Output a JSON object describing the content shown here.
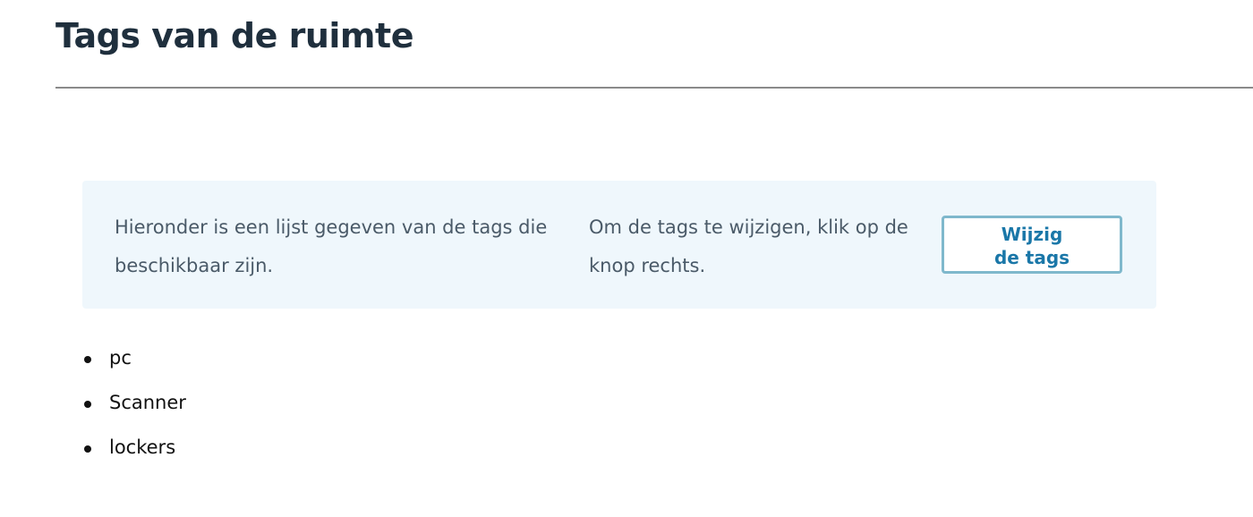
{
  "page": {
    "title": "Tags van de ruimte"
  },
  "info_panel": {
    "description": "Hieronder is een lijst gegeven van de tags die beschikbaar zijn.",
    "instruction": "Om de tags te wijzigen, klik op de knop rechts.",
    "edit_button": {
      "line1": "Wijzig",
      "line2": "de tags"
    }
  },
  "tags": [
    "pc",
    "Scanner",
    "lockers"
  ],
  "colors": {
    "title": "#1f2f3d",
    "panel_background": "#eff7fc",
    "panel_text": "#4a5a68",
    "button_border": "#7fb8cc",
    "button_text": "#1a77a8",
    "divider": "#8a8a8a"
  }
}
